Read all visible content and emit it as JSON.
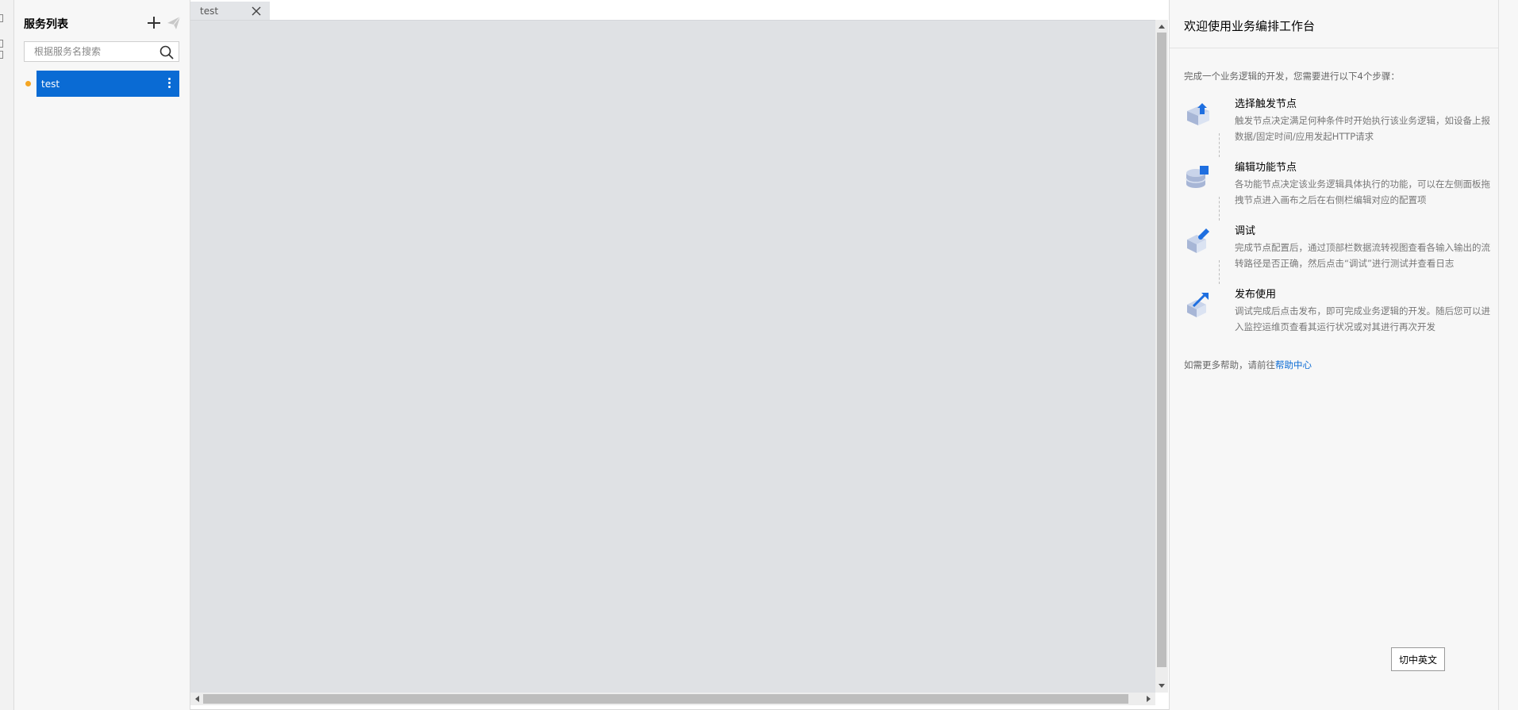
{
  "sidebar": {
    "title": "服务列表",
    "search_placeholder": "根据服务名搜索",
    "items": [
      {
        "label": "test",
        "status_color": "#f5a623"
      }
    ]
  },
  "tabs": [
    {
      "label": "test"
    }
  ],
  "guide": {
    "title": "欢迎使用业务编排工作台",
    "intro": "完成一个业务逻辑的开发，您需要进行以下4个步骤：",
    "steps": [
      {
        "title": "选择触发节点",
        "desc": "触发节点决定满足何种条件时开始执行该业务逻辑，如设备上报数据/固定时间/应用发起HTTP请求",
        "icon": "trigger-node-icon"
      },
      {
        "title": "编辑功能节点",
        "desc": "各功能节点决定该业务逻辑具体执行的功能，可以在左侧面板拖拽节点进入画布之后在右侧栏编辑对应的配置项",
        "icon": "function-node-icon"
      },
      {
        "title": "调试",
        "desc": "完成节点配置后，通过顶部栏数据流转视图查看各输入输出的流转路径是否正确，然后点击“调试”进行测试并查看日志",
        "icon": "debug-icon"
      },
      {
        "title": "发布使用",
        "desc": "调试完成后点击发布，即可完成业务逻辑的开发。随后您可以进入监控运维页查看其运行状况或对其进行再次开发",
        "icon": "publish-icon"
      }
    ],
    "help_prefix": "如需更多帮助，请前往",
    "help_link": "帮助中心",
    "lang_button": "切中英文"
  },
  "colors": {
    "accent": "#0a6bd4",
    "status_dot": "#f5a623",
    "canvas_bg": "#dfe1e4"
  }
}
